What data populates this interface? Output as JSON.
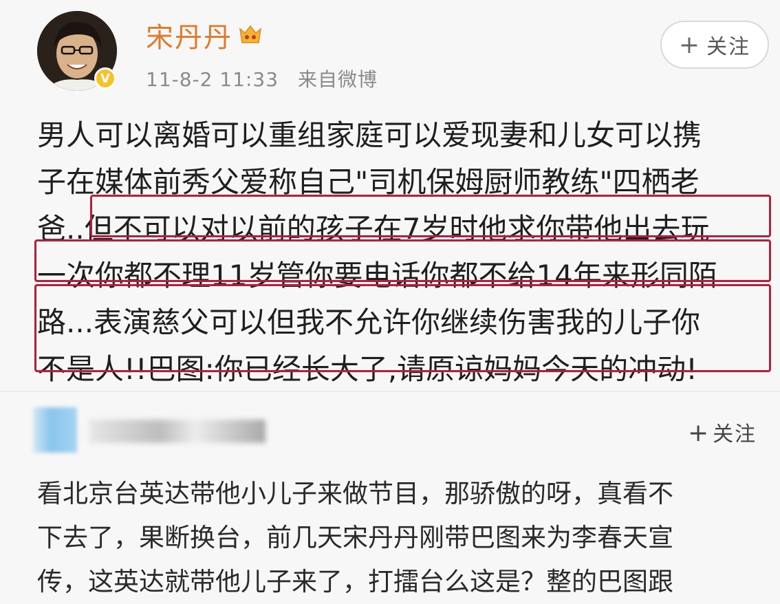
{
  "post": {
    "author": "宋丹丹",
    "timestamp": "11-8-2 11:33",
    "source": "来自微博",
    "follow_label": "关注",
    "lines": [
      "男人可以离婚可以重组家庭可以爱现妻和儿女可以携",
      "子在媒体前秀父爱称自己\"司机保姆厨师教练\"四栖老",
      "爸..但不可以对以前的孩子在7岁时他求你带他出去玩",
      "一次你都不理11岁管你要电话你都不给14年来形同陌",
      "路...表演慈父可以但我不允许你继续伤害我的儿子你",
      "不是人!!巴图:你已经长大了,请原谅妈妈今天的冲动!"
    ]
  },
  "comment": {
    "follow_label": "关注",
    "lines": [
      "看北京台英达带他小儿子来做节目，那骄傲的呀，真看不",
      "下去了，果断换台，前几天宋丹丹刚带巴图来为李春天宣",
      "传，这英达就带他儿子来了，打擂台么这是？整的巴图跟"
    ]
  },
  "colors": {
    "username": "#e07a2a",
    "highlight_border": "#b51f3c",
    "verified_badge": "#f6c22a"
  },
  "icons": {
    "verified": "verified-badge-icon",
    "vip": "vip-crown-icon",
    "plus": "plus-icon"
  }
}
